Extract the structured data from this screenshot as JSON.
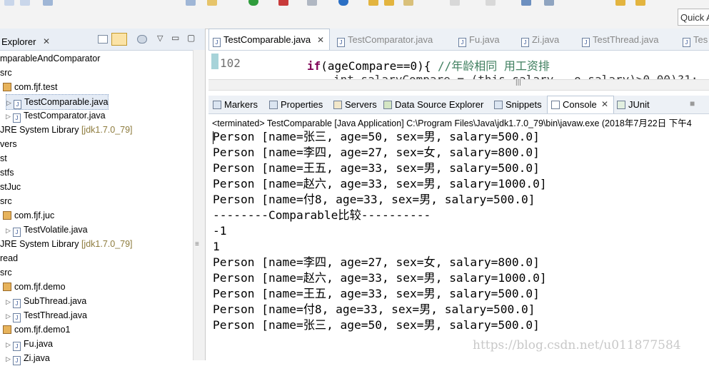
{
  "toolbar": {
    "quick_access_label": "Quick A"
  },
  "package_explorer": {
    "title": "Explorer",
    "items": [
      {
        "label": "mparableAndComparator",
        "indent": 0,
        "type": "project"
      },
      {
        "label": "src",
        "indent": 0,
        "type": "folder"
      },
      {
        "label": "com.fjf.test",
        "indent": 0,
        "type": "package"
      },
      {
        "label": "TestComparable.java",
        "indent": 1,
        "type": "file",
        "selected": true
      },
      {
        "label": "TestComparator.java",
        "indent": 1,
        "type": "file"
      },
      {
        "label": "JRE System Library",
        "suffix": "[jdk1.7.0_79]",
        "indent": 0,
        "type": "library"
      },
      {
        "label": "vers",
        "indent": 0,
        "type": "project"
      },
      {
        "label": "st",
        "indent": 0,
        "type": "project"
      },
      {
        "label": "stfs",
        "indent": 0,
        "type": "project"
      },
      {
        "label": "stJuc",
        "indent": 0,
        "type": "project"
      },
      {
        "label": "src",
        "indent": 0,
        "type": "folder"
      },
      {
        "label": "com.fjf.juc",
        "indent": 0,
        "type": "package"
      },
      {
        "label": "TestVolatile.java",
        "indent": 1,
        "type": "file"
      },
      {
        "label": "JRE System Library",
        "suffix": "[jdk1.7.0_79]",
        "indent": 0,
        "type": "library"
      },
      {
        "label": "read",
        "indent": 0,
        "type": "project"
      },
      {
        "label": "src",
        "indent": 0,
        "type": "folder"
      },
      {
        "label": "com.fjf.demo",
        "indent": 0,
        "type": "package"
      },
      {
        "label": "SubThread.java",
        "indent": 1,
        "type": "file"
      },
      {
        "label": "TestThread.java",
        "indent": 1,
        "type": "file"
      },
      {
        "label": "com.fjf.demo1",
        "indent": 0,
        "type": "package"
      },
      {
        "label": "Fu.java",
        "indent": 1,
        "type": "file"
      },
      {
        "label": "Zi.java",
        "indent": 1,
        "type": "file"
      }
    ]
  },
  "editor": {
    "tabs": [
      {
        "label": "TestComparable.java",
        "active": true
      },
      {
        "label": "TestComparator.java"
      },
      {
        "label": "Fu.java"
      },
      {
        "label": "Zi.java"
      },
      {
        "label": "TestThread.java"
      },
      {
        "label": "Tes"
      }
    ],
    "line_number": "102",
    "code_kw": "if",
    "code_rest": "(ageCompare==0){ ",
    "code_comment": "//年龄相同 用工资排",
    "code_next": "int salaryCompare = (this.salary - o.salary)>0.00)?1:"
  },
  "views": {
    "tabs": [
      {
        "label": "Markers"
      },
      {
        "label": "Properties"
      },
      {
        "label": "Servers"
      },
      {
        "label": "Data Source Explorer"
      },
      {
        "label": "Snippets"
      },
      {
        "label": "Console",
        "active": true
      },
      {
        "label": "JUnit"
      }
    ]
  },
  "console": {
    "terminated_line": "<terminated> TestComparable [Java Application] C:\\Program Files\\Java\\jdk1.7.0_79\\bin\\javaw.exe (2018年7月22日 下午4",
    "lines": [
      "Person [name=张三, age=50, sex=男, salary=500.0]",
      "Person [name=李四, age=27, sex=女, salary=800.0]",
      "Person [name=王五, age=33, sex=男, salary=500.0]",
      "Person [name=赵六, age=33, sex=男, salary=1000.0]",
      "Person [name=付8, age=33, sex=男, salary=500.0]",
      "--------Comparable比较----------",
      "-1",
      "1",
      "Person [name=李四, age=27, sex=女, salary=800.0]",
      "Person [name=赵六, age=33, sex=男, salary=1000.0]",
      "Person [name=王五, age=33, sex=男, salary=500.0]",
      "Person [name=付8, age=33, sex=男, salary=500.0]",
      "Person [name=张三, age=50, sex=男, salary=500.0]"
    ]
  },
  "watermark": "https://blog.csdn.net/u011877584"
}
